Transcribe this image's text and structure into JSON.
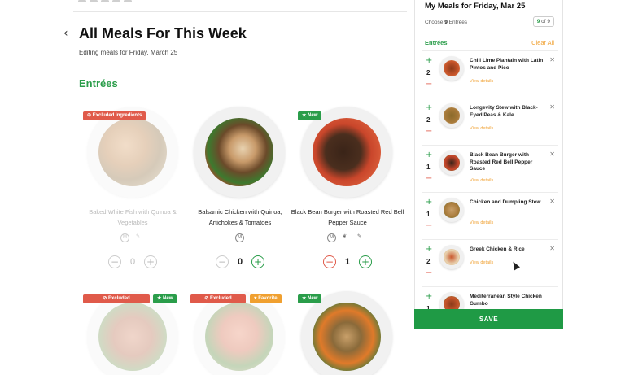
{
  "page": {
    "title": "All Meals For This Week",
    "subtitle": "Editing meals for Friday, March 25",
    "section": "Entrées",
    "back_icon": "chevron-left-icon"
  },
  "meals": [
    {
      "name": "Baked White Fish with Quinoa & Vegetables",
      "badges": [
        "Excluded ingredients"
      ],
      "quantity": "0",
      "excluded": true
    },
    {
      "name": "Balsamic Chicken with Quinoa, Artichokes & Tomatoes",
      "badges": [],
      "quantity": "0",
      "excluded": false
    },
    {
      "name": "Black Bean Burger with Roasted Red Bell Pepper Sauce",
      "badges": [
        "New"
      ],
      "quantity": "1",
      "excluded": false
    },
    {
      "name": "",
      "badges": [
        "Excluded",
        "New"
      ],
      "excluded": true
    },
    {
      "name": "",
      "badges": [
        "Excluded",
        "Favorite"
      ],
      "excluded": true
    },
    {
      "name": "",
      "badges": [
        "New"
      ],
      "excluded": false
    }
  ],
  "icons": {
    "m_label": "M",
    "stepper_minus": "−",
    "stepper_plus": "+"
  },
  "panel": {
    "title": "My Meals for Friday, Mar 25",
    "choose_prefix": "Choose",
    "choose_count": "9",
    "choose_suffix": "Entrées",
    "count_selected": "9",
    "count_total": "of 9",
    "entrees_label": "Entrées",
    "clear_all": "Clear All",
    "view_details": "View details",
    "save_label": "SAVE",
    "items": [
      {
        "name": "Chili Lime Plantain with Latin Pintos and Pico",
        "qty": "2"
      },
      {
        "name": "Longevity Stew with Black-Eyed Peas & Kale",
        "qty": "2"
      },
      {
        "name": "Black Bean Burger with Roasted Red Bell Pepper Sauce",
        "qty": "1"
      },
      {
        "name": "Chicken and Dumpling Stew",
        "qty": "1"
      },
      {
        "name": "Greek Chicken & Rice",
        "qty": "2"
      },
      {
        "name": "Mediterranean Style Chicken Gumbo",
        "qty": "1"
      }
    ]
  },
  "colors": {
    "accent_green": "#2a9d4a",
    "save_green": "#1f9a45",
    "excluded_red": "#e05a4a",
    "favorite_orange": "#f0a030"
  }
}
